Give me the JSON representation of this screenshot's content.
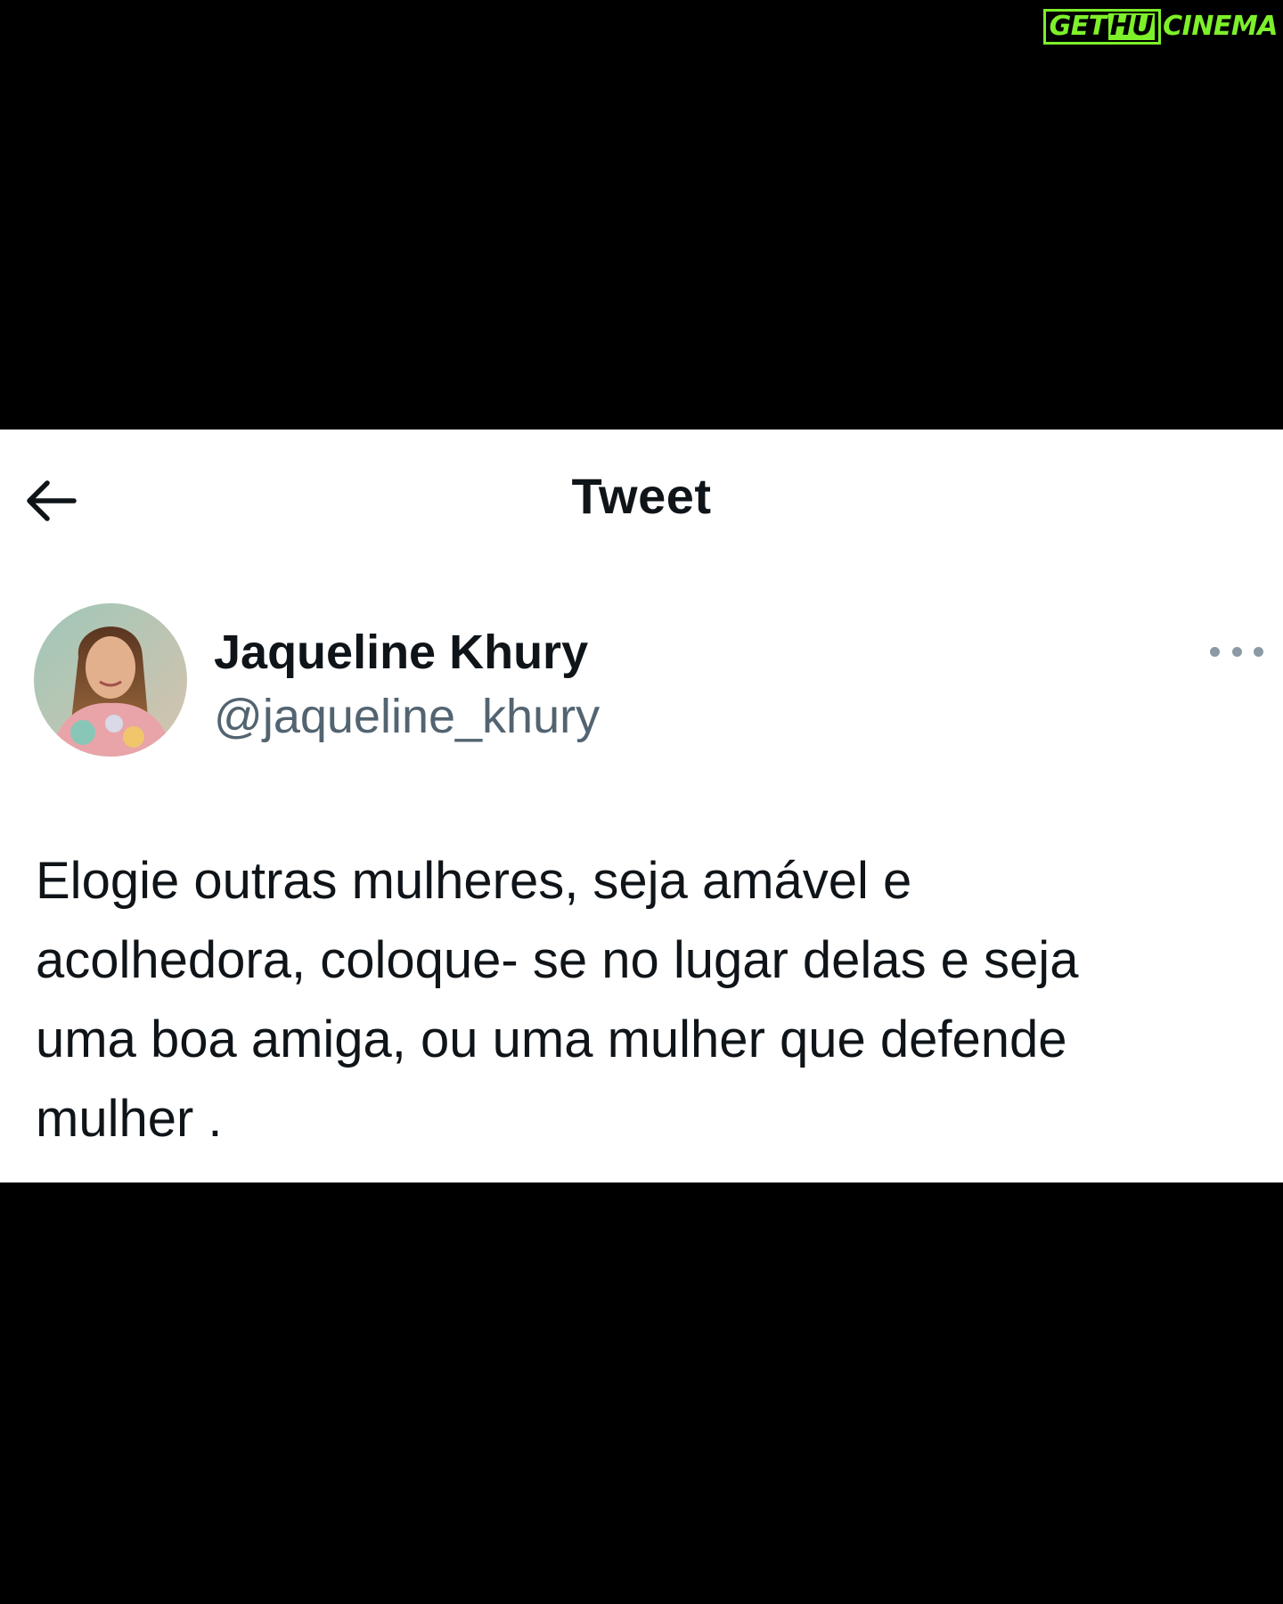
{
  "watermark": {
    "part1": "GET",
    "part2": "HU",
    "part3": "CINEMA",
    "color": "#7df02a"
  },
  "header": {
    "title": "Tweet",
    "back_icon": "arrow-left-icon"
  },
  "tweet": {
    "author": {
      "display_name": "Jaqueline Khury",
      "handle": "@jaqueline_khury",
      "avatar_icon": "avatar-photo"
    },
    "more_icon": "more-horizontal-icon",
    "text": "Elogie outras mulheres, seja amável e\nacolhedora, coloque- se no lugar delas e seja\numa boa amiga, ou uma mulher que defende\nmulher ."
  },
  "colors": {
    "background": "#000000",
    "card": "#ffffff",
    "primary_text": "#0f1419",
    "secondary_text": "#536471"
  }
}
